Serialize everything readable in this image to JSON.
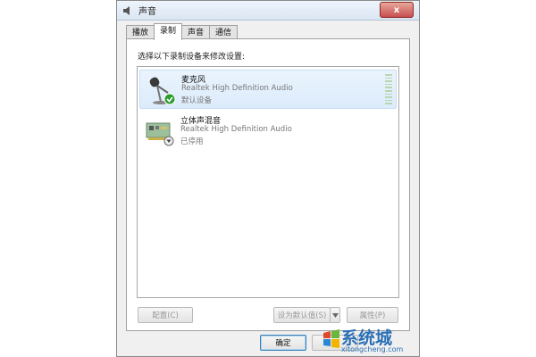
{
  "window": {
    "title": "声音",
    "close_label": "x"
  },
  "tabs": [
    {
      "label": "播放"
    },
    {
      "label": "录制"
    },
    {
      "label": "声音"
    },
    {
      "label": "通信"
    }
  ],
  "active_tab": "录制",
  "instruction": "选择以下录制设备来修改设置:",
  "devices": [
    {
      "name": "麦克风",
      "description": "Realtek High Definition Audio",
      "status": "默认设备",
      "icon": "microphone-icon",
      "badge": "check-badge-icon",
      "selected": true
    },
    {
      "name": "立体声混音",
      "description": "Realtek High Definition Audio",
      "status": "已停用",
      "icon": "sound-card-icon",
      "badge": "disabled-badge-icon",
      "selected": false
    }
  ],
  "buttons": {
    "configure": "配置(C)",
    "set_default": "设为默认值(S)",
    "properties": "属性(P)",
    "ok": "确定"
  },
  "watermark": {
    "text": "系统城",
    "url": "xitongcheng.com"
  }
}
